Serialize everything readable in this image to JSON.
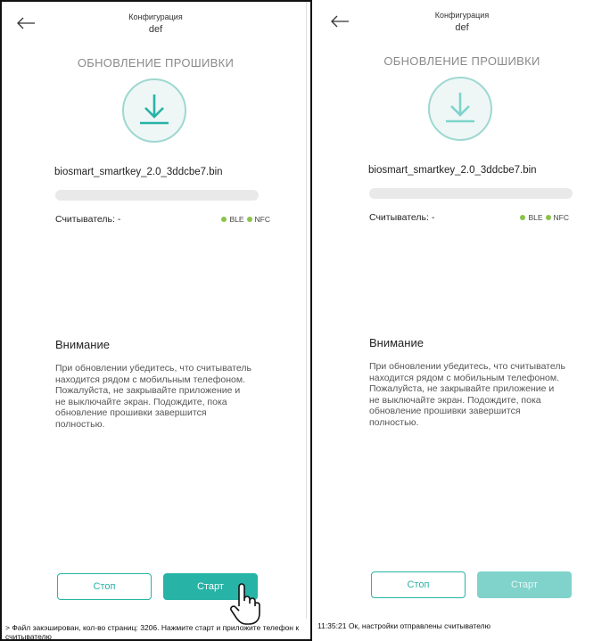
{
  "panels": [
    {
      "header": {
        "title": "Конфигурация",
        "subtitle": "def"
      },
      "section_title": "ОБНОВЛЕНИЕ ПРОШИВКИ",
      "file_name": "biosmart_smartkey_2.0_3ddcbe7.bin",
      "progress_fraction": 0,
      "reader_label": "Считыватель: -",
      "status": [
        "BLE",
        "NFC"
      ],
      "warning": {
        "title": "Внимание",
        "text": "При обновлении убедитесь, что считыватель находится рядом с мобильным телефоном. Пожалуйста, не закрывайте приложение и не выключайте экран. Подождите, пока обновление прошивки завершится полностью."
      },
      "buttons": {
        "stop": "Стоп",
        "start": "Старт"
      },
      "log": "> Файл закэширован, кол-во страниц: 3206. Нажмите старт и приложите телефон к считывателю"
    },
    {
      "header": {
        "title": "Конфигурация",
        "subtitle": "def"
      },
      "section_title": "ОБНОВЛЕНИЕ ПРОШИВКИ",
      "file_name": "biosmart_smartkey_2.0_3ddcbe7.bin",
      "progress_fraction": 0,
      "reader_label": "Считыватель: -",
      "status": [
        "BLE",
        "NFC"
      ],
      "warning": {
        "title": "Внимание",
        "text": "При обновлении убедитесь, что считыватель находится рядом с мобильным телефоном. Пожалуйста, не закрывайте приложение и не выключайте экран. Подождите, пока обновление прошивки завершится полностью."
      },
      "buttons": {
        "stop": "Стоп",
        "start": "Старт"
      },
      "log": "11:35:21 Ок, настройки отправлены считывателю"
    }
  ],
  "colors": {
    "accent": "#27b3a6",
    "accent_disabled": "#7fd3cb",
    "status_dot": "#8bc34a"
  },
  "icons": [
    "back-arrow-icon",
    "download-icon",
    "hand-pointer-icon"
  ]
}
